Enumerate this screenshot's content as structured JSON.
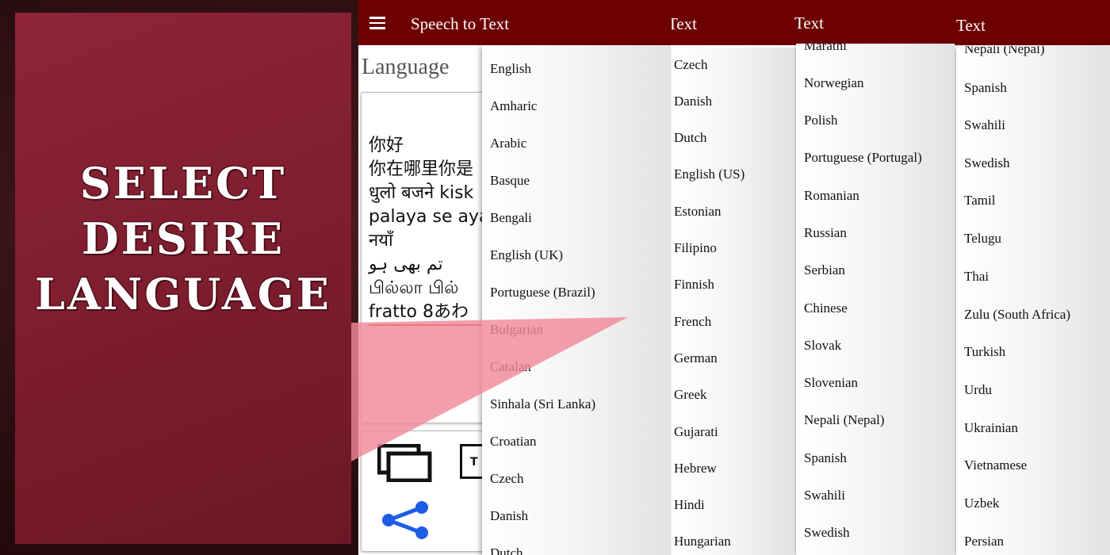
{
  "promo": {
    "headline_line1": "SELECT",
    "headline_line2": "DESIRE",
    "headline_line3": "LANGUAGE"
  },
  "main_screen": {
    "title": "Speech to Text",
    "language_label": "Language",
    "recognized_text": [
      "你好",
      "你在哪里你是",
      "धुलो बजने kisk",
      "palaya se aya",
      "नयाँ",
      " تم بھی ہو",
      "பில்லா பில்",
      "fratto 8あわ"
    ],
    "icons": [
      "menu-icon",
      "copy-icon",
      "text-icon",
      "share-icon"
    ],
    "text_icon_label": "T"
  },
  "dropdown_main": {
    "options": [
      "English",
      "Amharic",
      "Arabic",
      "Basque",
      "Bengali",
      "English (UK)",
      "Portuguese (Brazil)",
      "Bulgarian",
      "Catalan",
      "Sinhala (Sri Lanka)",
      "Croatian",
      "Czech",
      "Danish",
      "Dutch"
    ]
  },
  "screen_2": {
    "title": "Text",
    "options": [
      "Czech",
      "Danish",
      "Dutch",
      "English (US)",
      "Estonian",
      "Filipino",
      "Finnish",
      "French",
      "German",
      "Greek",
      "Gujarati",
      "Hebrew",
      "Hindi",
      "Hungarian"
    ]
  },
  "screen_3": {
    "title": "Text",
    "options": [
      "Marathi",
      "Norwegian",
      "Polish",
      "Portuguese (Portugal)",
      "Romanian",
      "Russian",
      "Serbian",
      "Chinese",
      "Slovak",
      "Slovenian",
      "Nepali (Nepal)",
      "Spanish",
      "Swahili",
      "Swedish"
    ]
  },
  "screen_4": {
    "title": "Text",
    "options": [
      "Nepali (Nepal)",
      "Spanish",
      "Swahili",
      "Swedish",
      "Tamil",
      "Telugu",
      "Thai",
      "Zulu (South Africa)",
      "Turkish",
      "Urdu",
      "Ukrainian",
      "Vietnamese",
      "Uzbek",
      "Persian"
    ]
  },
  "colors": {
    "appbar": "#6d0000",
    "promo_card": "#8e2436",
    "accent_line": "#b71c1c",
    "share_icon": "#1e5ce6",
    "pointer": "#f08a98"
  }
}
